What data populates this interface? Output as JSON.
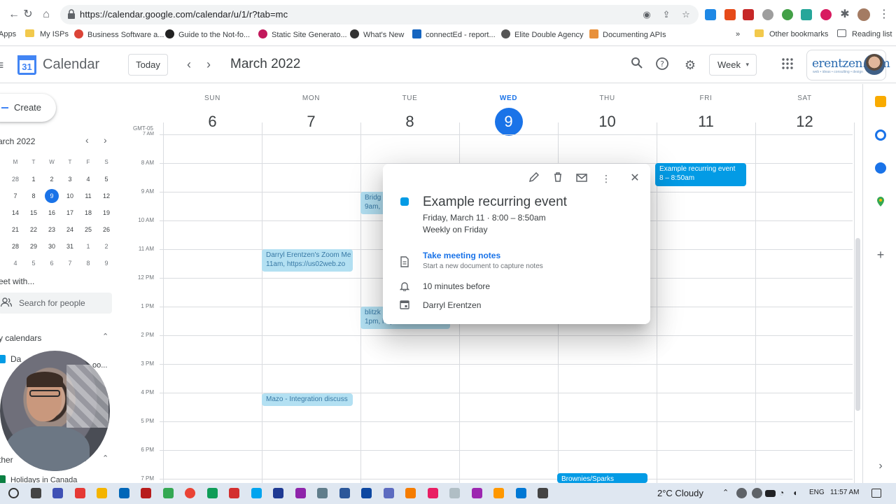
{
  "browser": {
    "url": "https://calendar.google.com/calendar/u/1/r?tab=mc",
    "bookmarks": [
      {
        "label": "Apps",
        "color": "#4285f4"
      },
      {
        "label": "My ISPs",
        "color": "#f2c94c"
      },
      {
        "label": "Business Software a...",
        "color": "#db4437"
      },
      {
        "label": "Guide to the Not-fo...",
        "color": "#222222"
      },
      {
        "label": "Static Site Generato...",
        "color": "#c2185b"
      },
      {
        "label": "What's New",
        "color": "#333333"
      },
      {
        "label": "connectEd - report...",
        "color": "#1565c0"
      },
      {
        "label": "Elite Double Agency",
        "color": "#555555"
      },
      {
        "label": "Documenting APIs",
        "color": "#e8903a"
      },
      {
        "label": "Other bookmarks",
        "color": "#f2c94c"
      },
      {
        "label": "Reading list",
        "color": "#5f6368"
      }
    ],
    "overflow": "»"
  },
  "header": {
    "logo_day": "31",
    "app_name": "Calendar",
    "today_label": "Today",
    "prev_label": "‹",
    "next_label": "›",
    "month_title": "March 2022",
    "view_label": "Week",
    "view_arrow": "▾",
    "brand": "erentzen.com",
    "brand_tagline": "web • ideas • consulting • design"
  },
  "sidebar": {
    "create_label": "Create",
    "mini_month": "arch 2022",
    "mini_prev": "‹",
    "mini_next": "›",
    "weekday_heads": [
      "M",
      "T",
      "W",
      "T",
      "F",
      "S"
    ],
    "weeks": [
      [
        "28",
        "1",
        "2",
        "3",
        "4",
        "5"
      ],
      [
        "7",
        "8",
        "9",
        "10",
        "11",
        "12"
      ],
      [
        "14",
        "15",
        "16",
        "17",
        "18",
        "19"
      ],
      [
        "21",
        "22",
        "23",
        "24",
        "25",
        "26"
      ],
      [
        "28",
        "29",
        "30",
        "31",
        "1",
        "2"
      ],
      [
        "4",
        "5",
        "6",
        "7",
        "8",
        "9"
      ]
    ],
    "meet_with": "eet with...",
    "search_people_placeholder": "Search for people",
    "my_calendars": "y calendars",
    "cal_item_1": "Da",
    "cal_item_1_tail": "oo...",
    "other_calendars": "ther",
    "other_add": "+",
    "holidays": "Holidays in Canada",
    "toggle": "⌃"
  },
  "grid": {
    "gmt": "GMT-05",
    "days": [
      {
        "dow": "SUN",
        "num": "6"
      },
      {
        "dow": "MON",
        "num": "7"
      },
      {
        "dow": "TUE",
        "num": "8"
      },
      {
        "dow": "WED",
        "num": "9"
      },
      {
        "dow": "THU",
        "num": "10"
      },
      {
        "dow": "FRI",
        "num": "11"
      },
      {
        "dow": "SAT",
        "num": "12"
      }
    ],
    "current_day_index": 3,
    "time_labels": [
      "7 AM",
      "8 AM",
      "9 AM",
      "10 AM",
      "11 AM",
      "12 PM",
      "1 PM",
      "2 PM",
      "3 PM",
      "4 PM",
      "5 PM",
      "6 PM",
      "7 PM"
    ]
  },
  "events": [
    {
      "title": "Darryl Erentzen's Zoom Me",
      "sub": "11am, https://us02web.zo",
      "style": "light"
    },
    {
      "title": "Bridg",
      "sub": "9am,",
      "style": "light"
    },
    {
      "title": "blitzk",
      "sub": "1pm, https://us02web.zo",
      "style": "light"
    },
    {
      "title": "Mazo - Integration discuss",
      "sub": "",
      "style": "light"
    },
    {
      "title": "Example recurring event",
      "sub": "8 – 8:50am",
      "style": "solid"
    },
    {
      "title": "Brownies/Sparks",
      "sub": "",
      "style": "solid"
    }
  ],
  "popover": {
    "title": "Example recurring event",
    "when": "Friday, March 11  ·  8:00 – 8:50am",
    "repeat": "Weekly on Friday",
    "notes_link": "Take meeting notes",
    "notes_sub": "Start a new document to capture notes",
    "reminder": "10 minutes before",
    "owner": "Darryl Erentzen",
    "color": "#039be5"
  },
  "taskbar": {
    "weather": "2°C  Cloudy",
    "lang": "ENG",
    "time": "11:57 AM"
  }
}
